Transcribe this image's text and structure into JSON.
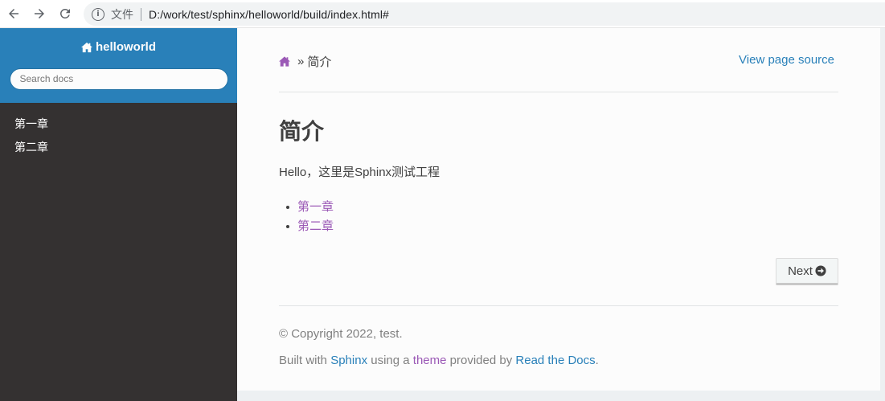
{
  "browser": {
    "file_label": "文件",
    "url": "D:/work/test/sphinx/helloworld/build/index.html#"
  },
  "sidebar": {
    "project_name": "helloworld",
    "search_placeholder": "Search docs",
    "toc": [
      {
        "label": "第一章"
      },
      {
        "label": "第二章"
      }
    ]
  },
  "content": {
    "breadcrumb_current": "简介",
    "breadcrumb_separator": "»",
    "view_source": "View page source",
    "title": "简介",
    "body": "Hello，这里是Sphinx测试工程",
    "links": [
      {
        "label": "第一章"
      },
      {
        "label": "第二章"
      }
    ],
    "next_label": "Next"
  },
  "footer": {
    "copyright": "© Copyright 2022, test.",
    "built_prefix": "Built with",
    "sphinx_link": "Sphinx",
    "using_a": "using a",
    "theme_link": "theme",
    "provided_by": "provided by",
    "rtd_link": "Read the Docs",
    "period": "."
  },
  "colors": {
    "sidebar_accent": "#2980b9",
    "sidebar_bg": "#343131",
    "link_blue": "#2980b9",
    "link_purple": "#9b59b6"
  },
  "icons": {
    "back": "arrow-left-icon",
    "forward": "arrow-right-icon",
    "reload": "reload-icon",
    "info": "info-icon",
    "home": "home-icon",
    "next": "circle-arrow-right-icon"
  }
}
